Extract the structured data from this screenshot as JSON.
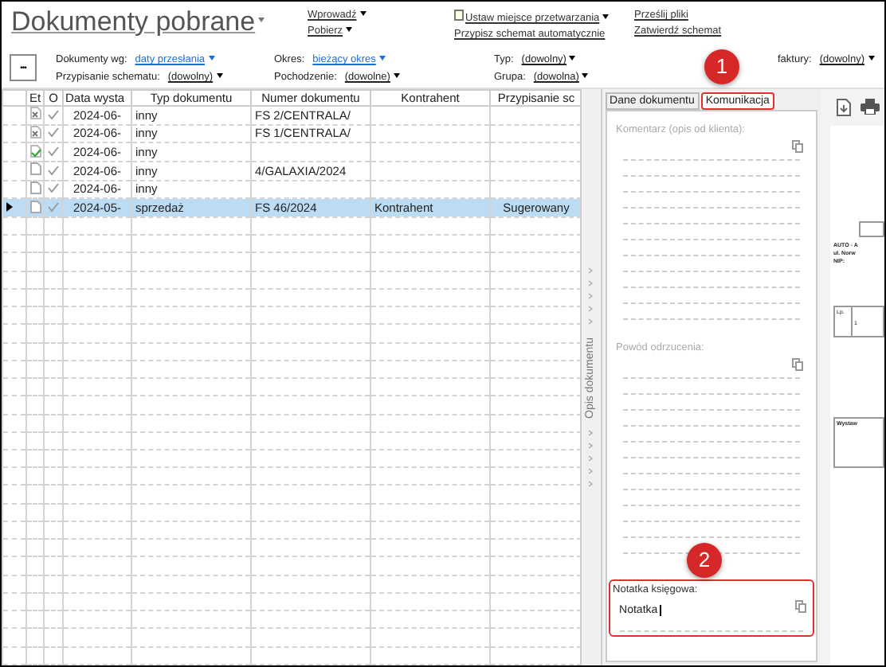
{
  "title": "Dokumenty pobrane",
  "actions": [
    [
      {
        "label": "Wprowadź",
        "dropdown": true,
        "icon": false
      },
      {
        "label": "Pobierz",
        "dropdown": true,
        "icon": false
      }
    ],
    [
      {
        "label": "Ustaw miejsce przetwarzania",
        "dropdown": true,
        "icon": true
      },
      {
        "label": "Przypisz schemat automatycznie",
        "dropdown": false,
        "icon": false
      }
    ],
    [
      {
        "label": "Prześlij pliki",
        "dropdown": false,
        "icon": false
      },
      {
        "label": "Zatwierdź schemat",
        "dropdown": false,
        "icon": false
      }
    ]
  ],
  "more_button": "•••",
  "filters": [
    [
      {
        "label": "Dokumenty wg:",
        "value": "daty przesłania",
        "highlighted": true
      },
      {
        "label": "Przypisanie schematu:",
        "value": "(dowolny)",
        "highlighted": false
      }
    ],
    [
      {
        "label": "Okres:",
        "value": "bieżący okres",
        "highlighted": true
      },
      {
        "label": "Pochodzenie:",
        "value": "(dowolne)",
        "highlighted": false
      }
    ],
    [
      {
        "label": "Typ:",
        "value": "(dowolny)",
        "highlighted": false
      },
      {
        "label": "Grupa:",
        "value": "(dowolna)",
        "highlighted": false
      }
    ],
    [
      {
        "label": "faktury:",
        "value": "(dowolny)",
        "highlighted": false
      }
    ]
  ],
  "grid": {
    "columns": [
      "Et",
      "O",
      "Data wysta",
      "Typ dokumentu",
      "Numer dokumentu",
      "Kontrahent",
      "Przypisanie sc"
    ],
    "rows": [
      {
        "kind": "rejected",
        "date": "2024-06-",
        "type": "inny",
        "number": "FS 2/CENTRALA/",
        "selected": false
      },
      {
        "kind": "rejected",
        "date": "2024-06-",
        "type": "inny",
        "number": "FS 1/CENTRALA/",
        "selected": false
      },
      {
        "kind": "approved",
        "date": "2024-06-",
        "type": "inny",
        "selected": false
      },
      {
        "kind": "new",
        "date": "2024-06-",
        "type": "inny",
        "number": "4/GALAXIA/2024",
        "selected": false
      },
      {
        "kind": "new",
        "date": "2024-06-",
        "type": "inny",
        "selected": false
      },
      {
        "kind": "new",
        "date": "2024-05-",
        "type": "sprzedaż",
        "number": "FS 46/2024",
        "contractor": "Kontrahent",
        "assignment": "Sugerowany",
        "selected": true
      }
    ]
  },
  "side_panel": {
    "splitter_label": "Opis dokumentu",
    "tabs": [
      {
        "label": "Dane dokumentu",
        "selected": false
      },
      {
        "label": "Komunikacja",
        "selected": true
      }
    ],
    "sections": [
      {
        "label": "Komentarz (opis od klienta):",
        "highlighted": false
      },
      {
        "label": "Powód odrzucenia:",
        "highlighted": false
      },
      {
        "label": "Notatka księgowa:",
        "value": "Notatka",
        "highlighted": true
      }
    ]
  },
  "callouts": [
    "1",
    "2"
  ],
  "preview": {
    "company": [
      "AUTO - A",
      "ul. Norw",
      "NIP:"
    ],
    "table_header": "Lp.",
    "table_cell": "1",
    "footer_header": "Wystaw"
  }
}
